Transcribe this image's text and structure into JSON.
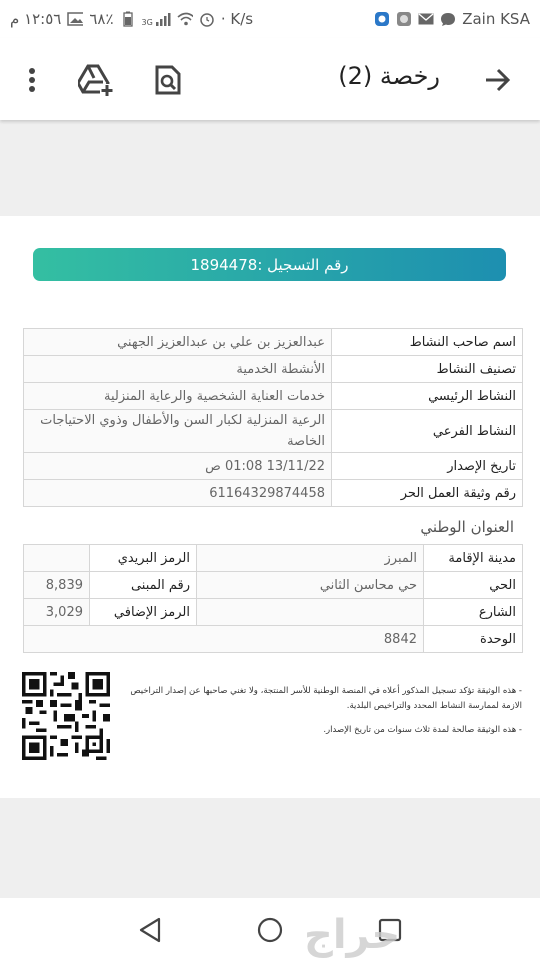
{
  "status": {
    "time": "١٢:٥٦ م",
    "battery": "٦٨٪",
    "network_type": "3G",
    "speed": "· K/s",
    "carrier": "Zain KSA"
  },
  "appbar": {
    "title": "رخصة (2)",
    "icons": [
      "more-vert-icon",
      "drive-add-icon",
      "find-in-file-icon",
      "arrow-forward-icon"
    ]
  },
  "document": {
    "registration": "رقم التسجيل :1894478",
    "activity": [
      {
        "label": "اسم صاحب النشاط",
        "value": "عبدالعزيز بن علي بن عبدالعزيز الجهني"
      },
      {
        "label": "تصنيف النشاط",
        "value": "الأنشطة الخدمية"
      },
      {
        "label": "النشاط الرئيسي",
        "value": "خدمات العناية الشخصية والرعاية المنزلية"
      },
      {
        "label": "النشاط الفرعي",
        "value": "الرعية المنزلية لكبار السن والأطفال وذوي الاحتياجات الخاصة"
      },
      {
        "label": "تاريخ الإصدار",
        "value": "13/11/22 01:08 ص"
      },
      {
        "label": "رقم وثيقة العمل الحر",
        "value": "61164329874458"
      }
    ],
    "address_title": "العنوان الوطني",
    "address": {
      "city_label": "مدينة الإقامة",
      "city_value": "المبرز",
      "postal_label": "الرمز البريدي",
      "postal_value": "",
      "district_label": "الحي",
      "district_value": "حي محاسن الثاني",
      "building_label": "رقم المبنى",
      "building_value": "8,839",
      "street_label": "الشارع",
      "street_value": "",
      "extra_label": "الرمز الإضافي",
      "extra_value": "3,029",
      "unit_label": "الوحدة",
      "unit_value": "8842"
    },
    "notes": [
      "- هذه الوثيقة تؤكد تسجيل المذكور أعلاه في المنصة الوطنية للأسر المنتجة، ولا تغني صاحبها عن إصدار التراخيص الازمة لممارسة النشاط المحدد والتراخيص البلدية.",
      "- هذه الوثيقة صالحة لمدة ثلاث سنوات من تاريخ الإصدار."
    ]
  },
  "watermark": "حراج",
  "colors": {
    "bar_start": "#34bfa2",
    "bar_end": "#1d8fb0"
  }
}
